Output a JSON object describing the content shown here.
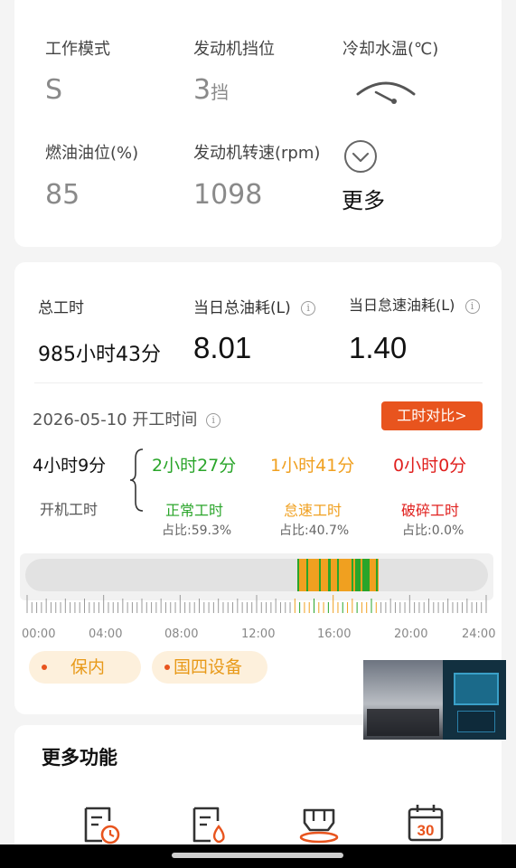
{
  "status": {
    "work_mode_label": "工作模式",
    "work_mode_value": "S",
    "gear_label": "发动机挡位",
    "gear_value": "3",
    "gear_unit": "挡",
    "coolant_label": "冷却水温(℃)",
    "fuel_label": "燃油油位(%)",
    "fuel_value": "85",
    "rpm_label": "发动机转速(rpm)",
    "rpm_value": "1098",
    "more_label": "更多"
  },
  "stats": {
    "total_hours_label": "总工时",
    "total_hours_value": "985小时43分",
    "daily_fuel_label": "当日总油耗(L)",
    "daily_fuel_value": "8.01",
    "idle_fuel_label": "当日怠速油耗(L)",
    "idle_fuel_value": "1.40"
  },
  "worktime": {
    "date_title": "2026-05-10 开工时间",
    "compare_button": "工时对比>",
    "on_time_value": "4小时9分",
    "on_time_label": "开机工时",
    "normal_value": "2小时27分",
    "normal_label": "正常工时",
    "normal_pct": "占比:59.3%",
    "idle_value": "1小时41分",
    "idle_label": "怠速工时",
    "idle_pct": "占比:40.7%",
    "break_value": "0小时0分",
    "break_label": "破碎工时",
    "break_pct": "占比:0.0%",
    "axis_labels": [
      "00:00",
      "04:00",
      "08:00",
      "12:00",
      "16:00",
      "20:00",
      "24:00"
    ]
  },
  "tags": {
    "warranty": "保内",
    "emission": "国四设备"
  },
  "more_functions": {
    "title": "更多功能"
  },
  "icons": [
    "report-clock-icon",
    "report-fuel-icon",
    "machine-icon",
    "calendar-icon"
  ],
  "calendar_day": "30",
  "colors": {
    "accent": "#e8541e",
    "normal": "#2aa52a",
    "idle": "#f0a020",
    "break": "#e0201e"
  }
}
